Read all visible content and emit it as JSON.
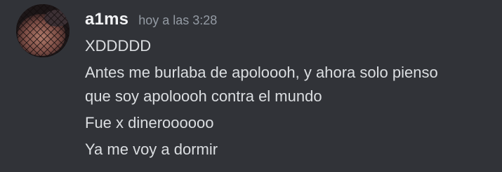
{
  "message": {
    "author": {
      "username": "a1ms",
      "avatar_icon": "user-avatar-icon"
    },
    "timestamp": "hoy a las 3:28",
    "lines": [
      "XDDDDD",
      "Antes me burlaba de apoloooh, y ahora solo pienso",
      "que soy apoloooh contra el mundo",
      "Fue x dineroooooo",
      "Ya me voy a dormir"
    ]
  },
  "colors": {
    "background": "#313338",
    "username": "#f2f3f5",
    "timestamp": "#949ba4",
    "text": "#dbdee1"
  }
}
